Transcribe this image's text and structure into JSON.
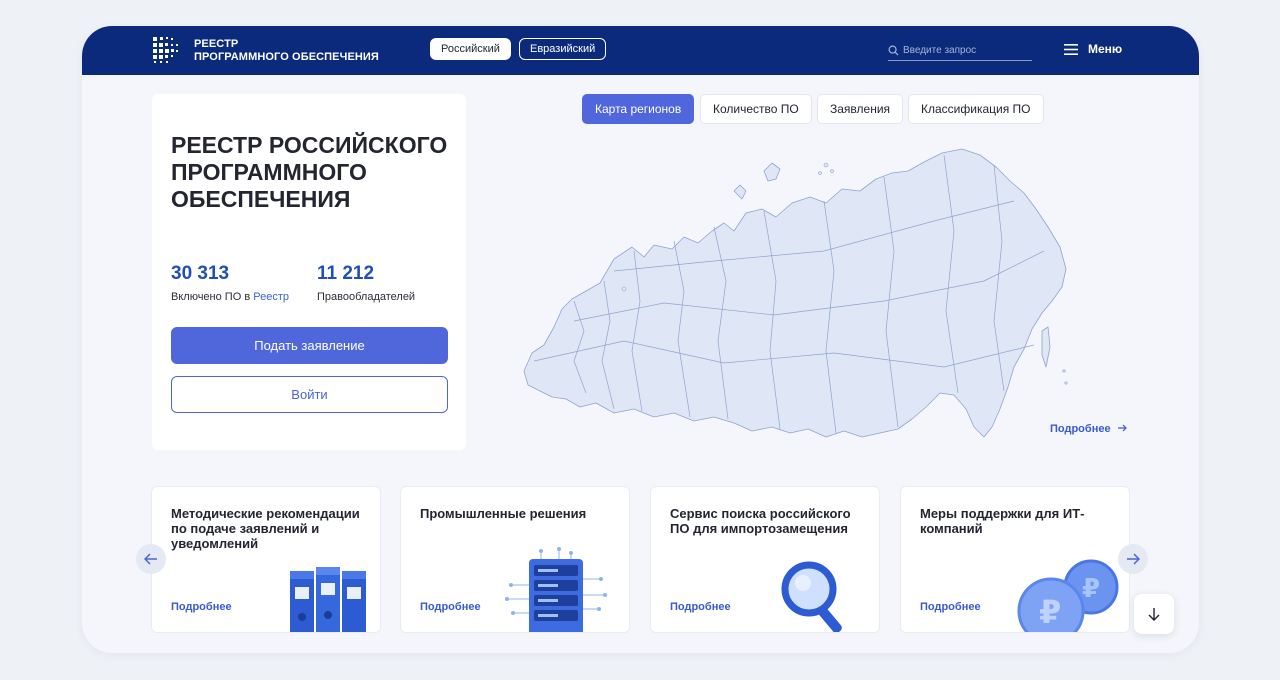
{
  "header": {
    "logo_line1": "РЕЕСТР",
    "logo_line2": "ПРОГРАММНОГО ОБЕСПЕЧЕНИЯ",
    "lang_active": "Российский",
    "lang_other": "Евразийский",
    "search_placeholder": "Введите запрос",
    "menu_label": "Меню"
  },
  "hero": {
    "title": "Реестр российского программного обеспечения",
    "stat1_value": "30 313",
    "stat1_label": "Включено ПО в",
    "stat1_link": "Реестр",
    "stat2_value": "11 212",
    "stat2_label": "Правообладателей",
    "apply_button": "Подать заявление",
    "login_button": "Войти"
  },
  "map": {
    "tabs": [
      "Карта регионов",
      "Количество ПО",
      "Заявления",
      "Классификация ПО"
    ],
    "active_tab": "Карта регионов",
    "more_link": "Подробнее"
  },
  "cards": [
    {
      "title": "Методические рекомендации по подаче заявлений и уведомлений",
      "more": "Подробнее",
      "icon": "folders-icon"
    },
    {
      "title": "Промышленные решения",
      "more": "Подробнее",
      "icon": "server-icon"
    },
    {
      "title": "Сервис поиска российского ПО для импортозамещения",
      "more": "Подробнее",
      "icon": "magnifier-icon"
    },
    {
      "title": "Меры поддержки для ИТ-компаний",
      "more": "Подробнее",
      "icon": "ruble-coins-icon"
    }
  ],
  "colors": {
    "header_bg": "#0b2a7c",
    "accent": "#5067dc",
    "link": "#3a5ad0",
    "map_fill": "#dfe7f7",
    "map_stroke": "#8fa2cf"
  }
}
